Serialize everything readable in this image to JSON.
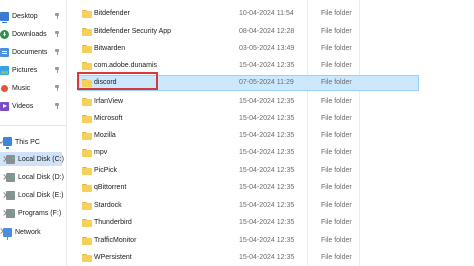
{
  "navigation": {
    "quick_access": [
      {
        "label": "Desktop",
        "icon": "desktop-icon",
        "pinned": true
      },
      {
        "label": "Downloads",
        "icon": "downloads-icon",
        "pinned": true
      },
      {
        "label": "Documents",
        "icon": "documents-icon",
        "pinned": true
      },
      {
        "label": "Pictures",
        "icon": "pictures-icon",
        "pinned": true
      },
      {
        "label": "Music",
        "icon": "music-icon",
        "pinned": true
      },
      {
        "label": "Videos",
        "icon": "videos-icon",
        "pinned": true
      }
    ],
    "this_pc": {
      "label": "This PC",
      "icon": "this-pc-icon"
    },
    "drives": [
      {
        "label": "Local Disk (C:)",
        "selected": true
      },
      {
        "label": "Local Disk (D:)",
        "selected": false
      },
      {
        "label": "Local Disk (E:)",
        "selected": false
      },
      {
        "label": "Programs (F:)",
        "selected": false
      }
    ],
    "network": {
      "label": "Network",
      "icon": "network-icon"
    }
  },
  "files": [
    {
      "name": "Bitdefender",
      "date": "10-04-2024 11:54",
      "type": "File folder"
    },
    {
      "name": "Bitdefender Security App",
      "date": "08-04-2024 12:28",
      "type": "File folder"
    },
    {
      "name": "Bitwarden",
      "date": "03-05-2024 13:49",
      "type": "File folder"
    },
    {
      "name": "com.adobe.dunamis",
      "date": "15-04-2024 12:35",
      "type": "File folder"
    },
    {
      "name": "discord",
      "date": "07-05-2024 11:29",
      "type": "File folder",
      "selected": true
    },
    {
      "name": "IrfanView",
      "date": "15-04-2024 12:35",
      "type": "File folder"
    },
    {
      "name": "Microsoft",
      "date": "15-04-2024 12:35",
      "type": "File folder"
    },
    {
      "name": "Mozilla",
      "date": "15-04-2024 12:35",
      "type": "File folder"
    },
    {
      "name": "mpv",
      "date": "15-04-2024 12:35",
      "type": "File folder"
    },
    {
      "name": "PicPick",
      "date": "15-04-2024 12:35",
      "type": "File folder"
    },
    {
      "name": "qBittorrent",
      "date": "15-04-2024 12:35",
      "type": "File folder"
    },
    {
      "name": "Stardock",
      "date": "15-04-2024 12:35",
      "type": "File folder"
    },
    {
      "name": "Thunderbird",
      "date": "15-04-2024 12:35",
      "type": "File folder"
    },
    {
      "name": "TrafficMonitor",
      "date": "15-04-2024 12:35",
      "type": "File folder"
    },
    {
      "name": "WPersistent",
      "date": "15-04-2024 12:35",
      "type": "File folder"
    }
  ],
  "colors": {
    "selection_fill": "#cce8ff",
    "selection_border": "#99d1ff",
    "highlight_box": "#d63a3a",
    "folder": "#f7cf5a"
  }
}
